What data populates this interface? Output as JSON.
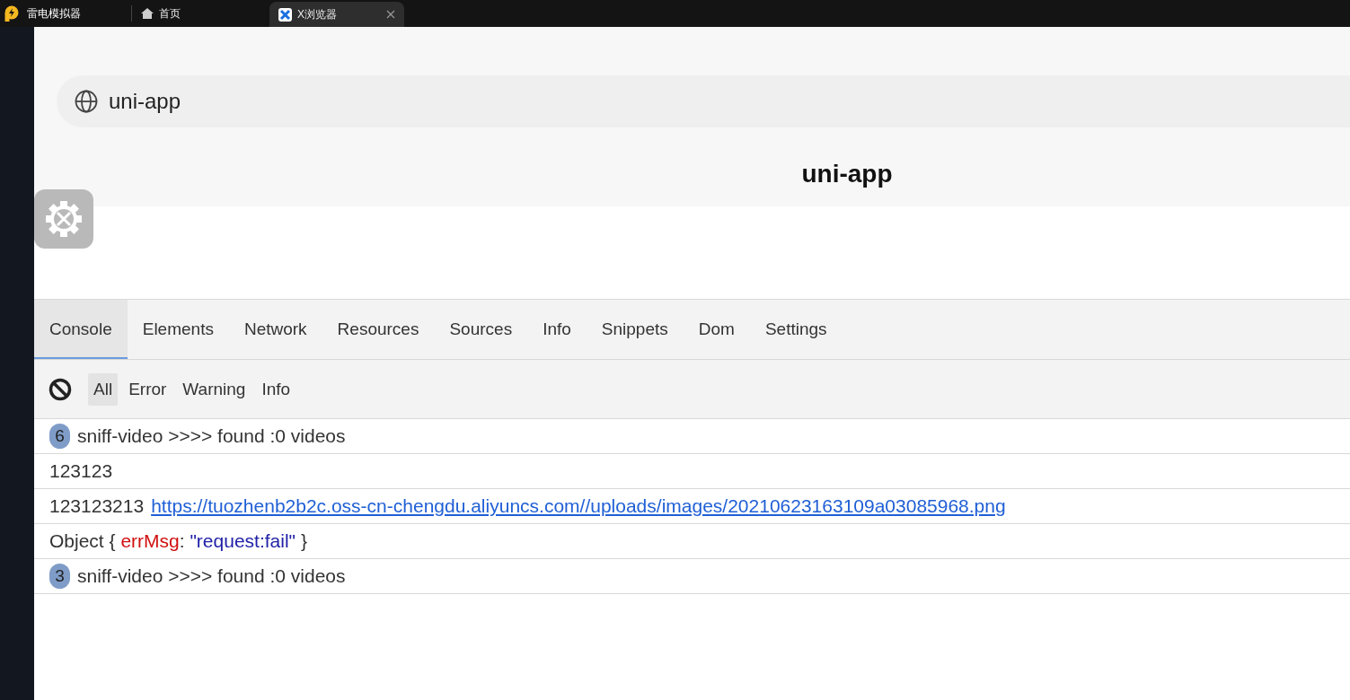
{
  "titlebar": {
    "app": "雷电模拟器",
    "tabs": [
      {
        "label": "首页",
        "kind": "home",
        "selected": false
      },
      {
        "label": "X浏览器",
        "kind": "browser",
        "selected": true
      }
    ]
  },
  "address_bar": {
    "value": "uni-app"
  },
  "page": {
    "title": "uni-app"
  },
  "devtools": {
    "tabs": [
      {
        "label": "Console",
        "selected": true
      },
      {
        "label": "Elements",
        "selected": false
      },
      {
        "label": "Network",
        "selected": false
      },
      {
        "label": "Resources",
        "selected": false
      },
      {
        "label": "Sources",
        "selected": false
      },
      {
        "label": "Info",
        "selected": false
      },
      {
        "label": "Snippets",
        "selected": false
      },
      {
        "label": "Dom",
        "selected": false
      },
      {
        "label": "Settings",
        "selected": false
      }
    ],
    "filters": [
      {
        "label": "All",
        "selected": true
      },
      {
        "label": "Error",
        "selected": false
      },
      {
        "label": "Warning",
        "selected": false
      },
      {
        "label": "Info",
        "selected": false
      }
    ],
    "logs": [
      {
        "kind": "repeat",
        "count": "6",
        "text": "sniff-video >>>> found :0 videos"
      },
      {
        "kind": "text",
        "text": "123123"
      },
      {
        "kind": "link",
        "text": "123123213",
        "url": "https://tuozhenb2b2c.oss-cn-chengdu.aliyuncs.com//uploads/images/20210623163109a03085968.png"
      },
      {
        "kind": "object",
        "text": "Object {",
        "key": "errMsg",
        "sep": ":",
        "value": "\"request:fail\"",
        "close": "}"
      },
      {
        "kind": "repeat",
        "count": "3",
        "text": "sniff-video >>>> found :0 videos"
      }
    ]
  }
}
